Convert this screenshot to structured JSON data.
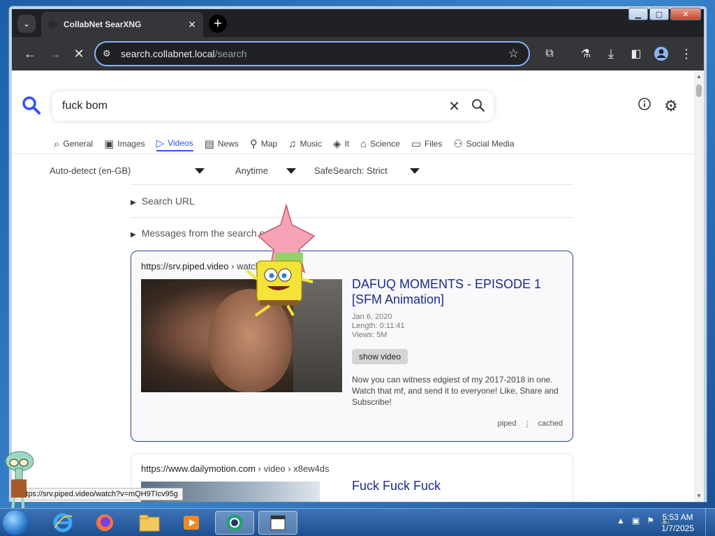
{
  "browser": {
    "tab_title": "CollabNet SearXNG",
    "url_host": "search.collabnet.local",
    "url_path": "/search"
  },
  "search": {
    "query": "fuck bom"
  },
  "categories": [
    {
      "label": "General",
      "icon": "search-icon"
    },
    {
      "label": "Images",
      "icon": "image-icon"
    },
    {
      "label": "Videos",
      "icon": "play-icon",
      "active": true
    },
    {
      "label": "News",
      "icon": "newspaper-icon"
    },
    {
      "label": "Map",
      "icon": "map-pin-icon"
    },
    {
      "label": "Music",
      "icon": "music-icon"
    },
    {
      "label": "It",
      "icon": "layers-icon"
    },
    {
      "label": "Science",
      "icon": "school-icon"
    },
    {
      "label": "Files",
      "icon": "files-icon"
    },
    {
      "label": "Social Media",
      "icon": "people-icon"
    }
  ],
  "filters": {
    "language": "Auto-detect (en-GB)",
    "time": "Anytime",
    "safesearch": "SafeSearch: Strict"
  },
  "panels": {
    "search_url": "Search URL",
    "messages": "Messages from the search engines"
  },
  "results": [
    {
      "url": "https://srv.piped.video",
      "crumb": "› watch",
      "title": "DAFUQ MOMENTS - EPISODE 1 [SFM Animation]",
      "date": "Jan 6, 2020",
      "length": "Length: 0:11:41",
      "views": "Views: 5M",
      "button": "show video",
      "description": "Now you can witness edgiest of my 2017-2018 in one. Watch that mf, and send it to everyone! Like, Share and Subscribe!",
      "engine": "piped",
      "cached": "cached"
    },
    {
      "url": "https://www.dailymotion.com",
      "crumb": "› video › x8ew4ds",
      "title": "Fuck Fuck Fuck"
    }
  ],
  "status_url": "https://srv.piped.video/watch?v=mQH9TIcv95g",
  "taskbar": {
    "time": "5:53 AM",
    "date": "1/7/2025"
  },
  "colors": {
    "accent": "#3050ff",
    "result_title": "#1a2a8c"
  }
}
